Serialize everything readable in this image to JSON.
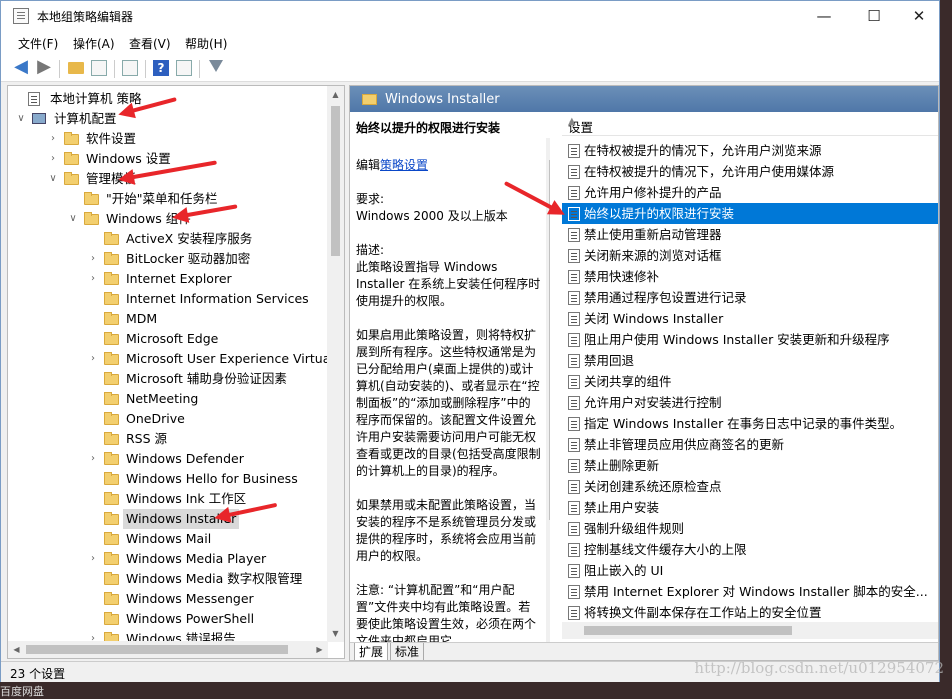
{
  "window": {
    "title": "本地组策略编辑器",
    "controls": {
      "minimize": "—",
      "maximize": "☐",
      "close": "✕"
    }
  },
  "menubar": {
    "items": [
      "文件(F)",
      "操作(A)",
      "查看(V)",
      "帮助(H)"
    ]
  },
  "toolbar": {
    "icons": [
      "back-arrow-icon",
      "forward-arrow-icon",
      "folder-up-icon",
      "show-hide-tree-icon",
      "export-list-icon",
      "help-icon",
      "properties-icon",
      "filter-icon"
    ]
  },
  "tree": {
    "items": [
      {
        "label": "本地计算机 策略",
        "level": 0,
        "expander": "",
        "icon": "policy-icon"
      },
      {
        "label": "计算机配置",
        "level": 0,
        "expander": "expanded",
        "icon": "computer-icon"
      },
      {
        "label": "软件设置",
        "level": 1,
        "expander": "collapsed",
        "icon": "folder-icon"
      },
      {
        "label": "Windows 设置",
        "level": 1,
        "expander": "collapsed",
        "icon": "folder-icon"
      },
      {
        "label": "管理模板",
        "level": 1,
        "expander": "expanded",
        "icon": "folder-icon"
      },
      {
        "label": "\"开始\"菜单和任务栏",
        "level": 2,
        "expander": "",
        "icon": "folder-icon"
      },
      {
        "label": "Windows 组件",
        "level": 2,
        "expander": "expanded",
        "icon": "folder-icon"
      },
      {
        "label": "ActiveX 安装程序服务",
        "level": 3,
        "expander": "",
        "icon": "folder-icon"
      },
      {
        "label": "BitLocker 驱动器加密",
        "level": 3,
        "expander": "collapsed",
        "icon": "folder-icon"
      },
      {
        "label": "Internet Explorer",
        "level": 3,
        "expander": "collapsed",
        "icon": "folder-icon"
      },
      {
        "label": "Internet Information Services",
        "level": 3,
        "expander": "",
        "icon": "folder-icon"
      },
      {
        "label": "MDM",
        "level": 3,
        "expander": "",
        "icon": "folder-icon"
      },
      {
        "label": "Microsoft Edge",
        "level": 3,
        "expander": "",
        "icon": "folder-icon"
      },
      {
        "label": "Microsoft User Experience Virtualizat",
        "level": 3,
        "expander": "collapsed",
        "icon": "folder-icon"
      },
      {
        "label": "Microsoft 辅助身份验证因素",
        "level": 3,
        "expander": "",
        "icon": "folder-icon"
      },
      {
        "label": "NetMeeting",
        "level": 3,
        "expander": "",
        "icon": "folder-icon"
      },
      {
        "label": "OneDrive",
        "level": 3,
        "expander": "",
        "icon": "folder-icon"
      },
      {
        "label": "RSS 源",
        "level": 3,
        "expander": "",
        "icon": "folder-icon"
      },
      {
        "label": "Windows Defender",
        "level": 3,
        "expander": "collapsed",
        "icon": "folder-icon"
      },
      {
        "label": "Windows Hello for Business",
        "level": 3,
        "expander": "",
        "icon": "folder-icon"
      },
      {
        "label": "Windows Ink 工作区",
        "level": 3,
        "expander": "",
        "icon": "folder-icon"
      },
      {
        "label": "Windows Installer",
        "level": 3,
        "expander": "",
        "icon": "folder-icon",
        "selected": true
      },
      {
        "label": "Windows Mail",
        "level": 3,
        "expander": "",
        "icon": "folder-icon"
      },
      {
        "label": "Windows Media Player",
        "level": 3,
        "expander": "collapsed",
        "icon": "folder-icon"
      },
      {
        "label": "Windows Media 数字权限管理",
        "level": 3,
        "expander": "",
        "icon": "folder-icon"
      },
      {
        "label": "Windows Messenger",
        "level": 3,
        "expander": "",
        "icon": "folder-icon"
      },
      {
        "label": "Windows PowerShell",
        "level": 3,
        "expander": "",
        "icon": "folder-icon"
      },
      {
        "label": "Windows 错误报告",
        "level": 3,
        "expander": "collapsed",
        "icon": "folder-icon"
      }
    ]
  },
  "right_header": {
    "title": "Windows Installer"
  },
  "description": {
    "heading": "始终以提升的权限进行安装",
    "edit_prefix": "编辑",
    "edit_link": "策略设置",
    "requirement_label": "要求:",
    "requirement_value": "Windows 2000 及以上版本",
    "description_label": "描述:",
    "paragraph1": "此策略设置指导 Windows Installer 在系统上安装任何程序时使用提升的权限。",
    "paragraph2": "如果启用此策略设置，则将特权扩展到所有程序。这些特权通常是为已分配给用户(桌面上提供的)或计算机(自动安装的)、或者显示在“控制面板”的“添加或删除程序”中的程序而保留的。该配置文件设置允许用户安装需要访问用户可能无权查看或更改的目录(包括受高度限制的计算机上的目录)的程序。",
    "paragraph3": "如果禁用或未配置此策略设置，当安装的程序不是系统管理员分发或提供的程序时，系统将会应用当前用户的权限。",
    "paragraph4": "注意: “计算机配置”和“用户配置”文件夹中均有此策略设置。若要使此策略设置生效，必须在两个文件夹中都启用它。"
  },
  "settings": {
    "column_header": "设置",
    "rows": [
      {
        "label": "在特权被提升的情况下，允许用户浏览来源"
      },
      {
        "label": "在特权被提升的情况下，允许用户使用媒体源"
      },
      {
        "label": "允许用户修补提升的产品"
      },
      {
        "label": "始终以提升的权限进行安装",
        "selected": true
      },
      {
        "label": "禁止使用重新启动管理器"
      },
      {
        "label": "关闭新来源的浏览对话框"
      },
      {
        "label": "禁用快速修补"
      },
      {
        "label": "禁用通过程序包设置进行记录"
      },
      {
        "label": "关闭 Windows Installer"
      },
      {
        "label": "阻止用户使用 Windows Installer 安装更新和升级程序"
      },
      {
        "label": "禁用回退"
      },
      {
        "label": "关闭共享的组件"
      },
      {
        "label": "允许用户对安装进行控制"
      },
      {
        "label": "指定 Windows Installer 在事务日志中记录的事件类型。"
      },
      {
        "label": "禁止非管理员应用供应商签名的更新"
      },
      {
        "label": "禁止删除更新"
      },
      {
        "label": "关闭创建系统还原检查点"
      },
      {
        "label": "禁止用户安装"
      },
      {
        "label": "强制升级组件规则"
      },
      {
        "label": "控制基线文件缓存大小的上限"
      },
      {
        "label": "阻止嵌入的 UI"
      },
      {
        "label": "禁用 Internet Explorer 对 Windows Installer 脚本的安全..."
      },
      {
        "label": "将转换文件副本保存在工作站上的安全位置"
      }
    ]
  },
  "tabs": [
    "扩展",
    "标准"
  ],
  "statusbar": {
    "text": "23 个设置"
  },
  "watermark": "http://blog.csdn.net/u012954072",
  "outside_text": "百度网盘",
  "colors": {
    "selection": "#0078d7",
    "annotation_arrow": "#e8262a",
    "header_blue": "#4f77a8"
  }
}
